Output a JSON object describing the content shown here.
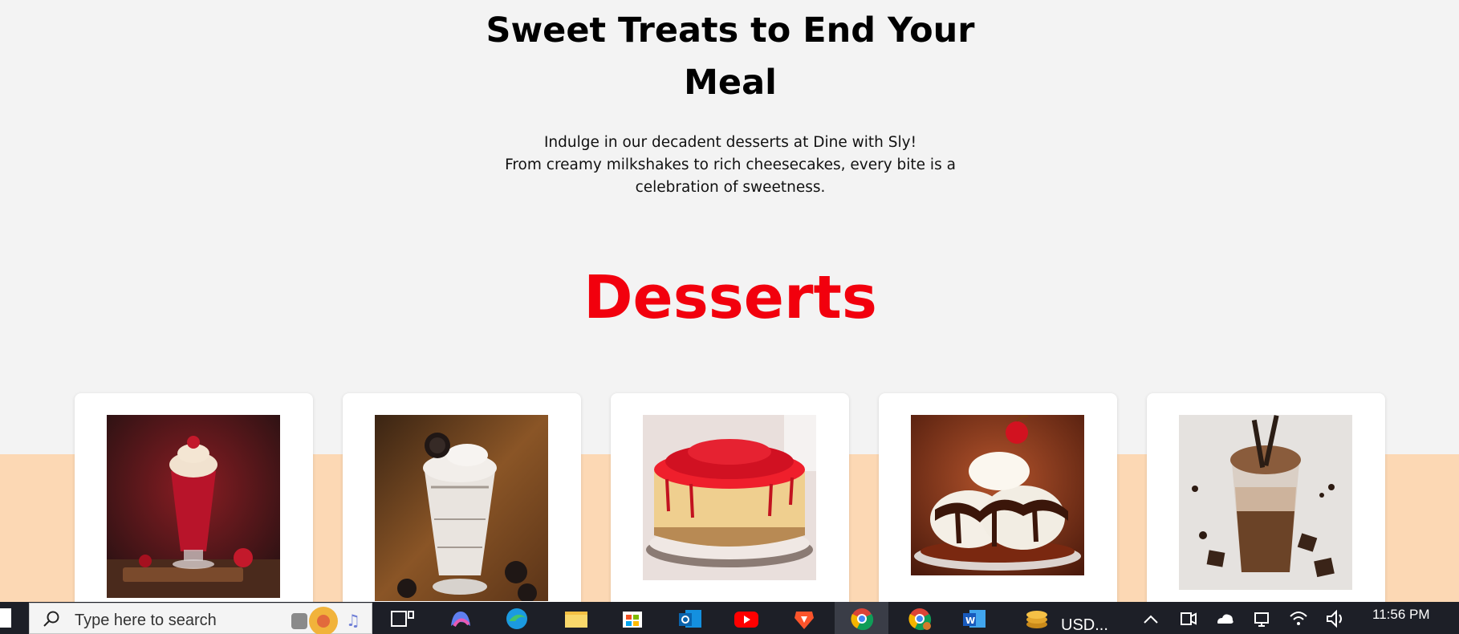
{
  "hero": {
    "title": "Sweet Treats to End Your Meal",
    "line1": "Indulge in our decadent desserts at Dine with Sly!",
    "line2": "From creamy milkshakes to rich cheesecakes, every bite is a celebration of sweetness."
  },
  "section": {
    "title": "Desserts"
  },
  "cards": [
    {
      "image": "red-velvet-milkshake-image"
    },
    {
      "image": "oreo-milkshake-image"
    },
    {
      "image": "strawberry-cheesecake-image"
    },
    {
      "image": "chocolate-sundae-image"
    },
    {
      "image": "chocolate-milkshake-image"
    }
  ],
  "taskbar": {
    "search_placeholder": "Type here to search",
    "usd_label": "USD...",
    "time": "11:56 PM",
    "apps": [
      "start-icon",
      "search-icon",
      "task-view-icon",
      "copilot-icon",
      "edge-icon",
      "file-explorer-icon",
      "store-icon",
      "outlook-icon",
      "youtube-icon",
      "brave-icon",
      "chrome-icon",
      "chrome-profile-icon",
      "word-icon",
      "coins-icon"
    ]
  },
  "colors": {
    "accent_red": "#f2000d",
    "peach_band": "#fcd8b4",
    "background": "#f3f3f3"
  }
}
